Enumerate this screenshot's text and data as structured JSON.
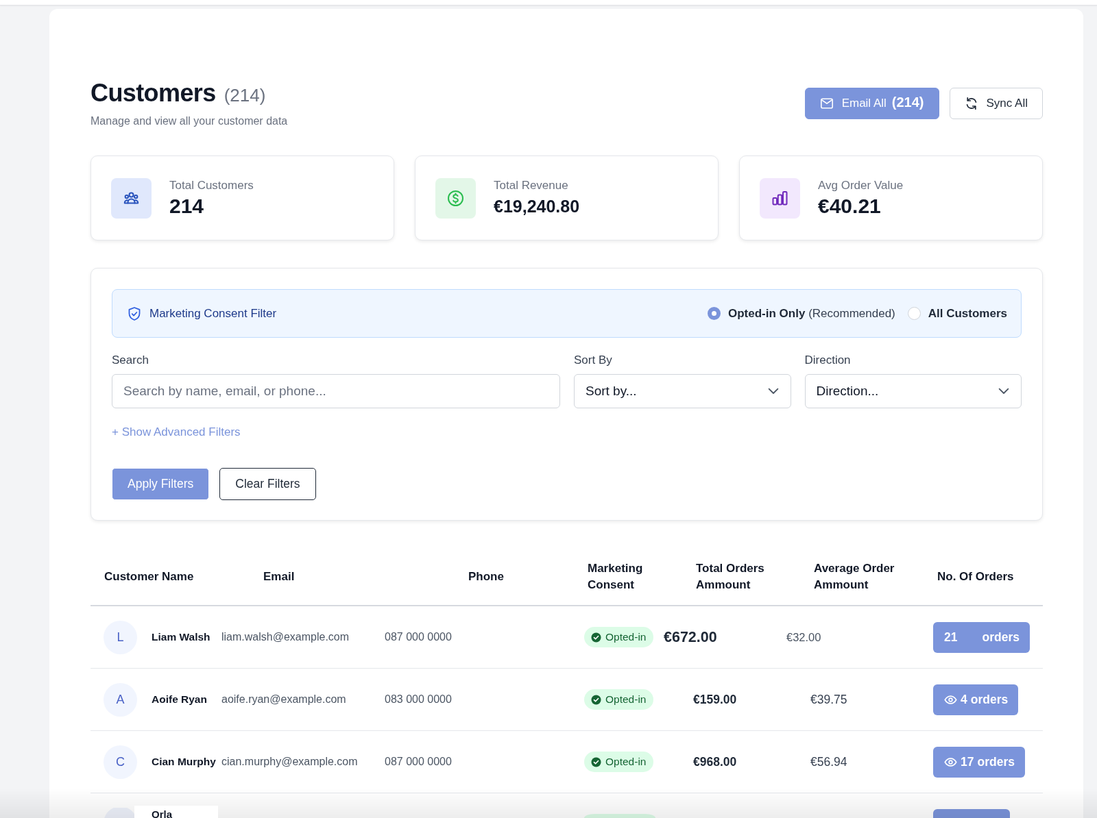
{
  "header": {
    "title": "Customers",
    "count": "(214)",
    "subtitle": "Manage and view all your customer data",
    "actions": [
      {
        "label": "Email All",
        "count": "(214)",
        "kind": "primary"
      },
      {
        "label": "Sync All",
        "kind": "outline"
      }
    ]
  },
  "stats": [
    {
      "label": "Total Customers",
      "value": "214",
      "color": "#e0e8fc"
    },
    {
      "label": "Total Revenue",
      "value": "€19,240.80",
      "color": "#e3f7e8"
    },
    {
      "label": "Avg Order Value",
      "value": "€40.21",
      "color": "#f2e8fd"
    }
  ],
  "filters": {
    "consent": {
      "title": "Marketing Consent Filter",
      "options": [
        {
          "label": "Opted-in Only",
          "note": "(Recommended)",
          "selected": true
        },
        {
          "label": "All Customers",
          "selected": false
        }
      ]
    },
    "fields": [
      {
        "label": "Search",
        "kind": "search",
        "placeholder": "Search by name, email, or phone..."
      },
      {
        "label": "Sort By",
        "kind": "select",
        "value": "Sort by..."
      },
      {
        "label": "Direction",
        "kind": "select",
        "value": "Direction..."
      }
    ],
    "advanced_link": "+ Show Advanced Filters",
    "buttons": [
      {
        "label": "Apply Filters",
        "kind": "primary"
      },
      {
        "label": "Clear Filters",
        "kind": "outline"
      }
    ]
  },
  "table": {
    "columns": [
      "Customer Name",
      "Email",
      "Phone",
      "Marketing Consent",
      "Total Orders Ammount",
      "Average Order Ammount",
      "No. Of Orders"
    ],
    "rows": [
      {
        "kind": "full",
        "initial": "L",
        "name": "Liam Walsh",
        "email": "liam.walsh@example.com",
        "phone": "087 000 0000",
        "consent": {
          "label": "Opted-in",
          "opted_in": true
        },
        "total": "€672.00",
        "average": "€32.00",
        "emphasized": true,
        "orders": {
          "kind": "split",
          "count": "21",
          "unit": "orders"
        }
      },
      {
        "kind": "full",
        "initial": "A",
        "name": "Aoife Ryan",
        "email": "aoife.ryan@example.com",
        "phone": "083 000 0000",
        "consent": {
          "label": "Opted-in",
          "opted_in": true
        },
        "total": "€159.00",
        "average": "€39.75",
        "emphasized": false,
        "orders": {
          "kind": "icon",
          "count": "4",
          "unit": "orders"
        }
      },
      {
        "kind": "full",
        "initial": "C",
        "name": "Cian Murphy",
        "email": "cian.murphy@example.com",
        "phone": "087 000 0000",
        "consent": {
          "label": "Opted-in",
          "opted_in": true
        },
        "total": "€968.00",
        "average": "€56.94",
        "emphasized": false,
        "orders": {
          "kind": "icon",
          "count": "17",
          "unit": "orders"
        }
      },
      {
        "kind": "partial",
        "name": "Orla",
        "consent": {
          "opted_in": true
        }
      }
    ]
  }
}
